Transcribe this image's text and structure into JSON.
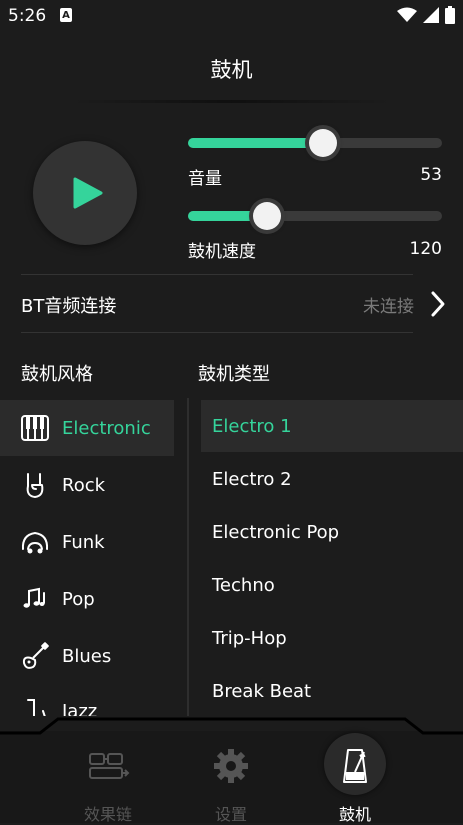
{
  "status_bar": {
    "time": "5:26",
    "a_badge": "A"
  },
  "header": {
    "title": "鼓机"
  },
  "player": {
    "volume": {
      "label": "音量",
      "value": "53",
      "level": 53,
      "max": 100
    },
    "tempo": {
      "label": "鼓机速度",
      "value": "120",
      "level_fraction": 0.31
    }
  },
  "bluetooth": {
    "label": "BT音频连接",
    "status": "未连接"
  },
  "styles": {
    "heading": "鼓机风格",
    "items": [
      {
        "label": "Electronic",
        "icon": "piano-keys-icon",
        "active": true
      },
      {
        "label": "Rock",
        "icon": "rock-hand-icon",
        "active": false
      },
      {
        "label": "Funk",
        "icon": "afro-hair-icon",
        "active": false
      },
      {
        "label": "Pop",
        "icon": "music-notes-icon",
        "active": false
      },
      {
        "label": "Blues",
        "icon": "guitar-icon",
        "active": false
      },
      {
        "label": "Jazz",
        "icon": "saxophone-icon",
        "active": false
      }
    ]
  },
  "types": {
    "heading": "鼓机类型",
    "items": [
      {
        "label": "Electro 1",
        "active": true
      },
      {
        "label": "Electro 2",
        "active": false
      },
      {
        "label": "Electronic Pop",
        "active": false
      },
      {
        "label": "Techno",
        "active": false
      },
      {
        "label": "Trip-Hop",
        "active": false
      },
      {
        "label": "Break Beat",
        "active": false
      }
    ]
  },
  "bottom_nav": {
    "items": [
      {
        "label": "效果链",
        "icon": "effects-chain-icon",
        "active": false
      },
      {
        "label": "设置",
        "icon": "gear-icon",
        "active": false
      },
      {
        "label": "鼓机",
        "icon": "metronome-icon",
        "active": true
      }
    ]
  },
  "colors": {
    "accent": "#35d49b",
    "background": "#1c1c1c",
    "inactive": "#555555"
  }
}
